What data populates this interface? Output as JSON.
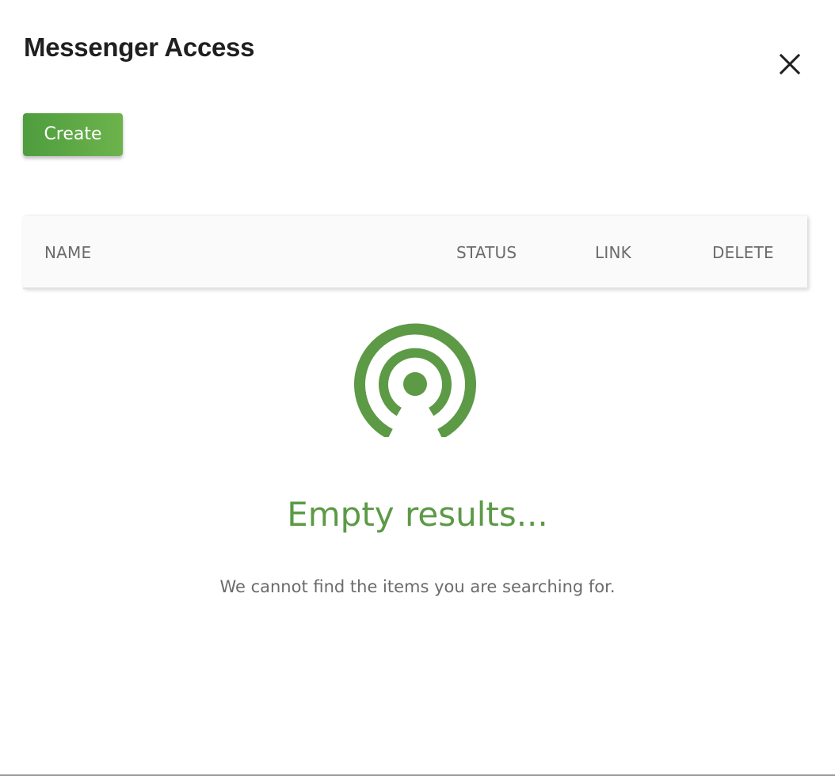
{
  "dialog": {
    "title": "Messenger Access",
    "close_icon": "close-icon"
  },
  "toolbar": {
    "create_label": "Create"
  },
  "table": {
    "columns": [
      "NAME",
      "STATUS",
      "LINK",
      "DELETE"
    ],
    "rows": []
  },
  "empty_state": {
    "icon": "broadcast-signal-icon",
    "title": "Empty results...",
    "message": "We cannot find the items you are searching for."
  },
  "colors": {
    "accent": "#5c9a46",
    "button_gradient_start": "#4e9d3e",
    "button_gradient_end": "#6db34c",
    "header_background": "#fafafa",
    "text_muted": "#6b6b6b"
  }
}
